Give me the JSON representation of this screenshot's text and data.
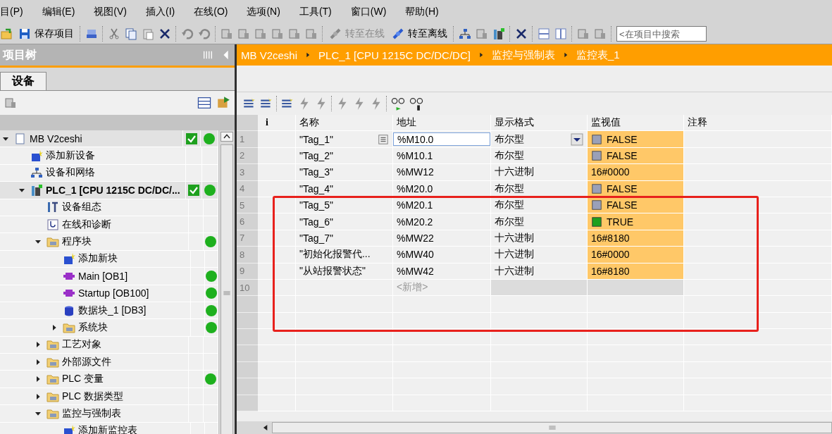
{
  "menu": [
    "目(P)",
    "编辑(E)",
    "视图(V)",
    "插入(I)",
    "在线(O)",
    "选项(N)",
    "工具(T)",
    "窗口(W)",
    "帮助(H)"
  ],
  "toolbar": {
    "save": {
      "label": "保存项目"
    },
    "go_online": {
      "label": "转至在线",
      "disabled": true
    },
    "go_offline": {
      "label": "转至离线",
      "disabled": false
    },
    "search": {
      "placeholder": "<在项目中搜索"
    }
  },
  "project_tree": {
    "title": "项目树",
    "tabs": [
      {
        "label": "设备",
        "selected": true
      }
    ],
    "items": [
      {
        "label": "MB V2ceshi",
        "kind": "project",
        "expanded": true,
        "consistent": true,
        "status_ok": true,
        "children": [
          {
            "label": "添加新设备",
            "kind": "add",
            "consistent": false,
            "status_ok": false
          },
          {
            "label": "设备和网络",
            "kind": "network",
            "consistent": false,
            "status_ok": false
          },
          {
            "label": "PLC_1 [CPU 1215C DC/DC/...",
            "kind": "plc",
            "expanded": true,
            "consistent": true,
            "status_ok": true,
            "children": [
              {
                "label": "设备组态",
                "kind": "config",
                "consistent": false,
                "status_ok": false
              },
              {
                "label": "在线和诊断",
                "kind": "diag",
                "consistent": false,
                "status_ok": false
              },
              {
                "label": "程序块",
                "kind": "folder",
                "expanded": true,
                "consistent": false,
                "status_ok": true,
                "children": [
                  {
                    "label": "添加新块",
                    "kind": "add",
                    "consistent": false,
                    "status_ok": false
                  },
                  {
                    "label": "Main [OB1]",
                    "kind": "block",
                    "consistent": false,
                    "status_ok": true
                  },
                  {
                    "label": "Startup [OB100]",
                    "kind": "block",
                    "consistent": false,
                    "status_ok": true
                  },
                  {
                    "label": "数据块_1 [DB3]",
                    "kind": "db",
                    "consistent": false,
                    "status_ok": true
                  },
                  {
                    "label": "系统块",
                    "kind": "folder",
                    "expanded": false,
                    "consistent": false,
                    "status_ok": true
                  }
                ]
              },
              {
                "label": "工艺对象",
                "kind": "folder",
                "expanded": false,
                "consistent": false,
                "status_ok": false
              },
              {
                "label": "外部源文件",
                "kind": "folder",
                "expanded": false,
                "consistent": false,
                "status_ok": false
              },
              {
                "label": "PLC 变量",
                "kind": "folder",
                "expanded": false,
                "consistent": false,
                "status_ok": true
              },
              {
                "label": "PLC 数据类型",
                "kind": "folder",
                "expanded": false,
                "consistent": false,
                "status_ok": false
              },
              {
                "label": "监控与强制表",
                "kind": "folder",
                "expanded": true,
                "consistent": false,
                "status_ok": false,
                "children": [
                  {
                    "label": "添加新监控表",
                    "kind": "add",
                    "consistent": false,
                    "status_ok": false
                  }
                ]
              }
            ]
          }
        ]
      }
    ]
  },
  "breadcrumb": [
    "MB V2ceshi",
    "PLC_1 [CPU 1215C DC/DC/DC]",
    "监控与强制表",
    "监控表_1"
  ],
  "watch_table": {
    "columns": [
      "i",
      "名称",
      "地址",
      "显示格式",
      "监视值",
      "注释"
    ],
    "rows": [
      {
        "num": "1",
        "kind": "bool",
        "name": "\"Tag_1\"",
        "address": "%M10.0",
        "format": "布尔型",
        "value": "FALSE",
        "on": false,
        "selected": true
      },
      {
        "num": "2",
        "kind": "bool",
        "name": "\"Tag_2\"",
        "address": "%M10.1",
        "format": "布尔型",
        "value": "FALSE",
        "on": false,
        "selected": false
      },
      {
        "num": "3",
        "kind": "hex",
        "name": "\"Tag_3\"",
        "address": "%MW12",
        "format": "十六进制",
        "value": "16#0000",
        "selected": false
      },
      {
        "num": "4",
        "kind": "bool",
        "name": "\"Tag_4\"",
        "address": "%M20.0",
        "format": "布尔型",
        "value": "FALSE",
        "on": false,
        "selected": false
      },
      {
        "num": "5",
        "kind": "bool",
        "name": "\"Tag_5\"",
        "address": "%M20.1",
        "format": "布尔型",
        "value": "FALSE",
        "on": false,
        "selected": false
      },
      {
        "num": "6",
        "kind": "bool",
        "name": "\"Tag_6\"",
        "address": "%M20.2",
        "format": "布尔型",
        "value": "TRUE",
        "on": true,
        "selected": false
      },
      {
        "num": "7",
        "kind": "hex",
        "name": "\"Tag_7\"",
        "address": "%MW22",
        "format": "十六进制",
        "value": "16#8180",
        "selected": false
      },
      {
        "num": "8",
        "kind": "hex",
        "name": "\"初始化报警代...",
        "address": "%MW40",
        "format": "十六进制",
        "value": "16#0000",
        "selected": false
      },
      {
        "num": "9",
        "kind": "hex",
        "name": "\"从站报警状态\"",
        "address": "%MW42",
        "format": "十六进制",
        "value": "16#8180",
        "selected": false
      },
      {
        "num": "10",
        "kind": "new",
        "address": "<新增>",
        "selected": false
      }
    ]
  }
}
